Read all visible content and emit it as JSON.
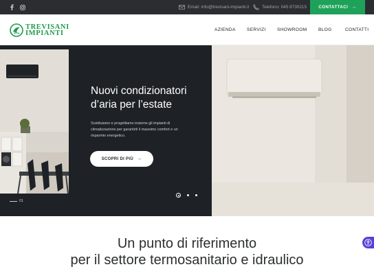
{
  "topbar": {
    "social": [
      {
        "name": "facebook-icon",
        "glyph": "f"
      },
      {
        "name": "instagram-icon",
        "glyph": "◎"
      }
    ],
    "email_label": "Email: info@trevisani-impianti.it",
    "phone_label": "Telefono: 045 8730215",
    "cta_label": "CONTATTACI",
    "cta_color": "#1ea25a"
  },
  "header": {
    "logo_line1": "TREVISANI",
    "logo_line2": "IMPIANTI",
    "brand_color": "#1e9a4b",
    "nav": {
      "azienda": "AZIENDA",
      "servizi": "SERVIZI",
      "showroom": "SHOWROOM",
      "blog": "BLOG",
      "contatti": "CONTATTI"
    }
  },
  "hero": {
    "title_line1": "Nuovi condizionatori",
    "title_line2": "d’aria per l’estate",
    "description": "Sostituiamo e progettiamo insieme gli impianti di climatizzazione per garantirti il massimo comfort e un risparmio energetico.",
    "button_label": "SCOPRI DI PIÙ",
    "slide_number": "01",
    "slides_total_dots": 3,
    "active_slide": 1
  },
  "intro": {
    "title_line1": "Un punto di riferimento",
    "title_line2": "per il settore termosanitario e idraulico"
  }
}
